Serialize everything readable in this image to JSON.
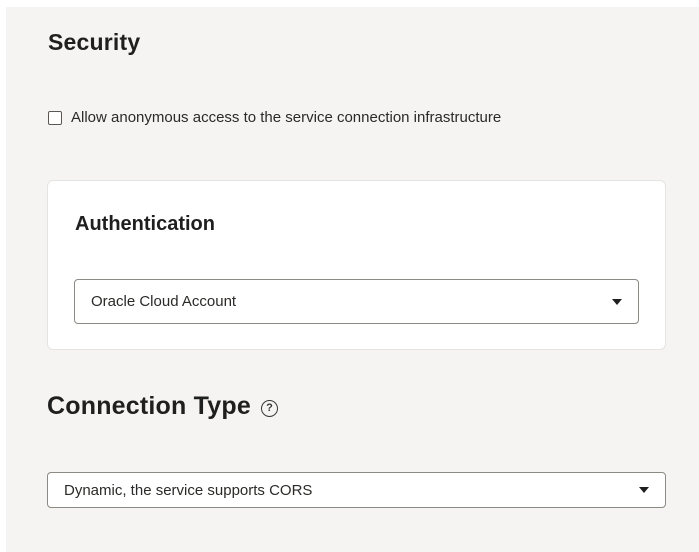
{
  "security": {
    "title": "Security",
    "anonymous_access_label": "Allow anonymous access to the service connection infrastructure",
    "anonymous_access_checked": false
  },
  "authentication": {
    "title": "Authentication",
    "selected": "Oracle Cloud Account"
  },
  "connection_type": {
    "title": "Connection Type",
    "help_glyph": "?",
    "selected": "Dynamic, the service supports CORS"
  },
  "icons": {
    "dropdown": "chevron-down-icon",
    "help": "help-icon",
    "checkbox": "checkbox-icon"
  },
  "colors": {
    "panel_bg": "#f5f4f2",
    "card_bg": "#ffffff",
    "text": "#1f1f1f",
    "border": "#8d8984"
  }
}
